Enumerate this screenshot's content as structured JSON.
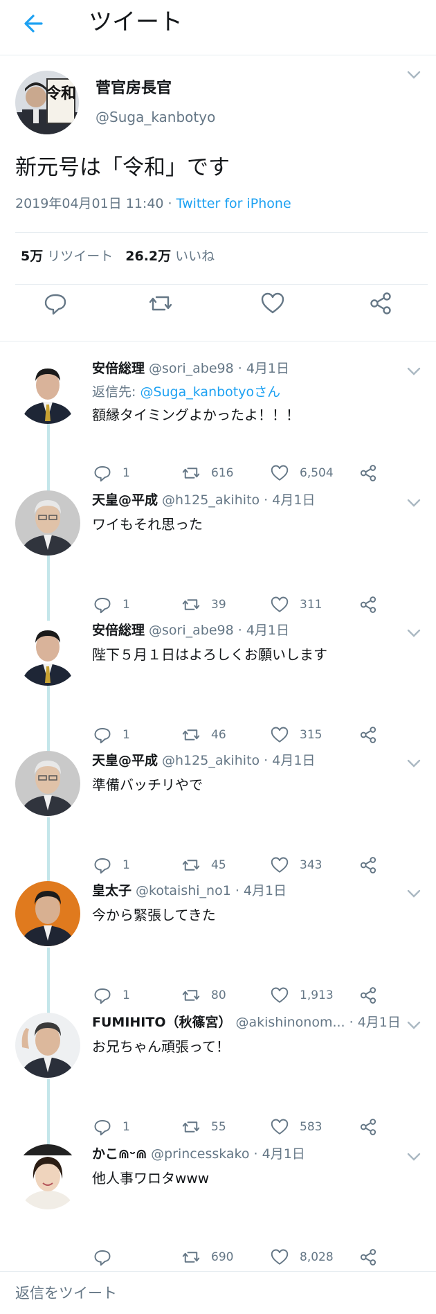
{
  "header": {
    "title": "ツイート",
    "back_icon": "arrow-left-icon",
    "accent_color": "#1da1f2"
  },
  "main_tweet": {
    "author_name": "菅官房長官",
    "handle": "@Suga_kanbotyo",
    "text": "新元号は「令和」です",
    "timestamp": "2019年04月01日 11:40 · ",
    "source": "Twitter for iPhone",
    "retweet_count": "5万",
    "retweet_label": "リツイート",
    "like_count": "26.2万",
    "like_label": "いいね",
    "avatar_text": "令和"
  },
  "replies": [
    {
      "name": "安倍総理",
      "handle": "@sori_abe98 · 4月1日",
      "reply_to_prefix": "返信先: ",
      "reply_to_mention": "@Suga_kanbotyoさん",
      "text": "額縁タイミングよかったよ！！！",
      "replies": "1",
      "retweets": "616",
      "likes": "6,504"
    },
    {
      "name": "天皇@平成",
      "handle": "@h125_akihito · 4月1日",
      "text": "ワイもそれ思った",
      "replies": "1",
      "retweets": "39",
      "likes": "311"
    },
    {
      "name": "安倍総理",
      "handle": "@sori_abe98 · 4月1日",
      "text": "陛下５月１日はよろしくお願いします",
      "replies": "1",
      "retweets": "46",
      "likes": "315"
    },
    {
      "name": "天皇@平成",
      "handle": "@h125_akihito · 4月1日",
      "text": "準備バッチリやで",
      "replies": "1",
      "retweets": "45",
      "likes": "343"
    },
    {
      "name": "皇太子",
      "handle": "@kotaishi_no1 · 4月1日",
      "text": "今から緊張してきた",
      "replies": "1",
      "retweets": "80",
      "likes": "1,913"
    },
    {
      "name": "FUMIHITO（秋篠宮）",
      "handle": "@akishinonom... · 4月1日",
      "text": "お兄ちゃん頑張って！",
      "replies": "1",
      "retweets": "55",
      "likes": "583"
    },
    {
      "name": "かこ⋒ᵕ⋒",
      "handle": "@princesskako · 4月1日",
      "text": "他人事ワロタwww",
      "replies": "",
      "retweets": "690",
      "likes": "8,028"
    }
  ],
  "compose": {
    "placeholder": "返信をツイート"
  }
}
